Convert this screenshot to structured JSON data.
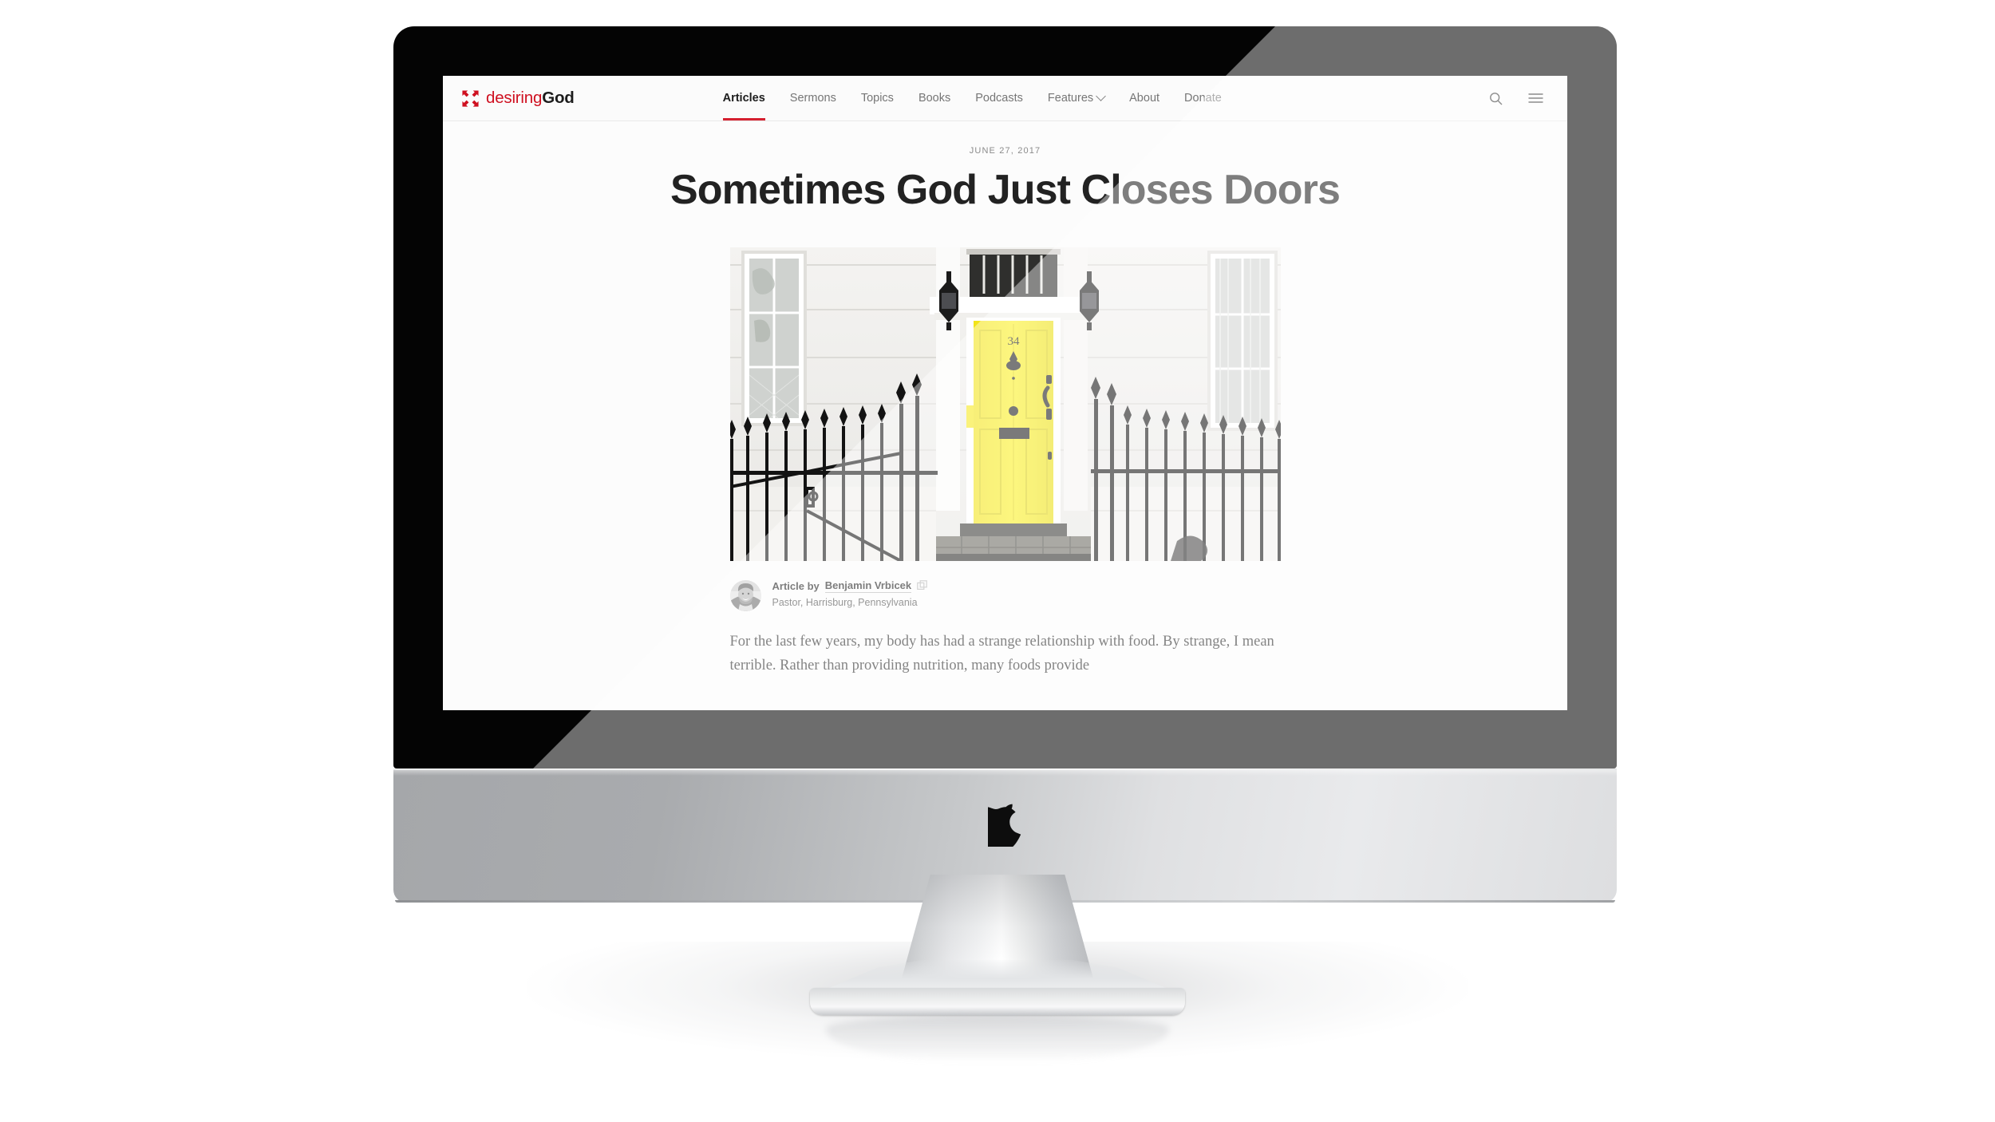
{
  "device": {
    "name": "Apple iMac",
    "apple_logo_icon": "apple-logo-icon"
  },
  "site": {
    "brand": {
      "mark_icon": "desiringgod-arrows-icon",
      "name_part_red": "desiring",
      "name_part_dark": "God",
      "brand_color": "#cf1020"
    },
    "nav": {
      "links": [
        {
          "label": "Articles",
          "active": true,
          "has_dropdown": false
        },
        {
          "label": "Sermons",
          "active": false,
          "has_dropdown": false
        },
        {
          "label": "Topics",
          "active": false,
          "has_dropdown": false
        },
        {
          "label": "Books",
          "active": false,
          "has_dropdown": false
        },
        {
          "label": "Podcasts",
          "active": false,
          "has_dropdown": false
        },
        {
          "label": "Features",
          "active": false,
          "has_dropdown": true
        },
        {
          "label": "About",
          "active": false,
          "has_dropdown": false
        },
        {
          "label": "Donate",
          "active": false,
          "has_dropdown": false
        }
      ],
      "active_underline_color": "#d5202f",
      "search_icon": "search-icon",
      "menu_icon": "hamburger-menu-icon"
    },
    "article": {
      "date": "JUNE 27, 2017",
      "title": "Sometimes God Just Closes Doors",
      "hero_alt": "yellow-front-door-photo",
      "hero_house_number": "34",
      "byline": {
        "label": "Article by",
        "author": "Benjamin Vrbicek",
        "copy_icon": "duplicate-copy-icon",
        "role": "Pastor, Harrisburg, Pennsylvania",
        "avatar_icon": "author-avatar"
      },
      "body_paragraph": "For the last few years, my body has had a strange relationship with food. By strange, I mean terrible. Rather than providing nutrition, many foods provide"
    }
  }
}
